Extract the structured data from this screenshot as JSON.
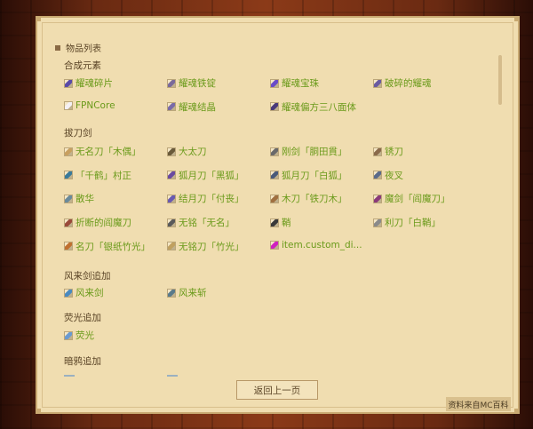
{
  "header": {
    "title": "物品列表"
  },
  "sections": [
    {
      "title": "合成元素"
    },
    {
      "title": "拔刀剑"
    },
    {
      "title": "风来剑追加"
    },
    {
      "title": "荧光追加"
    },
    {
      "title": "暗鸦追加"
    }
  ],
  "items": {
    "s0": [
      "耀魂碎片",
      "耀魂铁锭",
      "耀魂宝珠",
      "破碎的耀魂",
      "FPNCore",
      "耀魂结晶",
      "耀魂偏方三八面体"
    ],
    "s1": [
      "无名刀「木偶」",
      "大太刀",
      "刚剑「胴田貫」",
      "锈刀",
      "「千鹤」村正",
      "狐月刀「黑狐」",
      "狐月刀「白狐」",
      "夜叉",
      "散华",
      "结月刀「付丧」",
      "木刀「铁刀木」",
      "魔剑「阎魔刀」",
      "折断的阎魔刀",
      "无铭「无名」",
      "鞘",
      "利刀「白鞘」",
      "名刀「银纸竹光」",
      "无铭刀「竹光」",
      "item.custom_di..."
    ],
    "s2": [
      "风来剑",
      "风来斩"
    ],
    "s3": [
      "荧光"
    ]
  },
  "icon_colors": {
    "s0": [
      "#5a4aa8",
      "#7a6a9a",
      "#6a4ac8",
      "#6a5aa0",
      "#f4f0f4",
      "#7a6aa8",
      "#4a3a7a"
    ],
    "s1": [
      "#c8a060",
      "#6a5a3a",
      "#6a6a6a",
      "#8a6a4a",
      "#3a7a9a",
      "#6a4aa0",
      "#4a5a7a",
      "#5a6a8a",
      "#6a8a9a",
      "#6a5ab0",
      "#a07040",
      "#8a3a7a",
      "#9a4a3a",
      "#5a5a5a",
      "#3a3a3a",
      "#8a8a8a",
      "#c07030",
      "#c0a060",
      "#d020c0"
    ],
    "s2": [
      "#4a8ac0",
      "#5a7a8a"
    ],
    "s3": [
      "#6a9ad0"
    ]
  },
  "button": {
    "back": "返回上一页"
  },
  "credit": "资料来自MC百科",
  "colors": {
    "item_text": "#6a9a1a",
    "section_text": "#5a4426",
    "panel_bg": "#f0ddb0"
  }
}
